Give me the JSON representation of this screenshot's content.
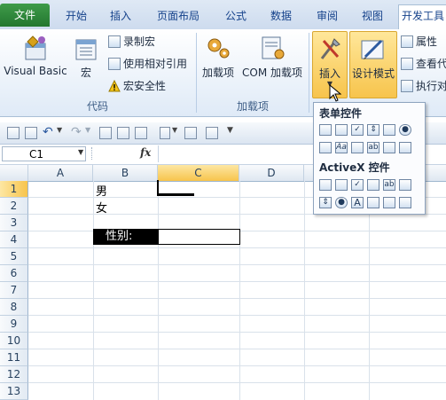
{
  "tabs": {
    "file": "文件",
    "home": "开始",
    "insert": "插入",
    "page_layout": "页面布局",
    "formulas": "公式",
    "data": "数据",
    "review": "审阅",
    "view": "视图",
    "developer": "开发工具"
  },
  "ribbon": {
    "code": {
      "label": "代码",
      "visual_basic": "Visual Basic",
      "macros": "宏",
      "record_macro": "录制宏",
      "relative_ref": "使用相对引用",
      "macro_security": "宏安全性"
    },
    "addins": {
      "label": "加载项",
      "addins": "加载项",
      "com_addins": "COM 加载项"
    },
    "controls": {
      "insert": "插入",
      "design_mode": "设计模式",
      "properties": "属性",
      "view_code": "查看代",
      "run_dialog": "执行对"
    }
  },
  "insert_menu": {
    "form_controls": "表单控件",
    "activex_controls": "ActiveX 控件"
  },
  "formula_bar": {
    "name_box": "C1",
    "fx": "fx",
    "value": ""
  },
  "columns": [
    "A",
    "B",
    "C",
    "D"
  ],
  "rows": [
    "1",
    "2",
    "3",
    "4",
    "5",
    "6",
    "7",
    "8",
    "9",
    "10",
    "11",
    "12",
    "13"
  ],
  "cells": {
    "B1": "男",
    "B2": "女",
    "B4": "性别:"
  },
  "colors": {
    "accent": "#f7c44c",
    "file_tab": "#2f8a3b"
  }
}
